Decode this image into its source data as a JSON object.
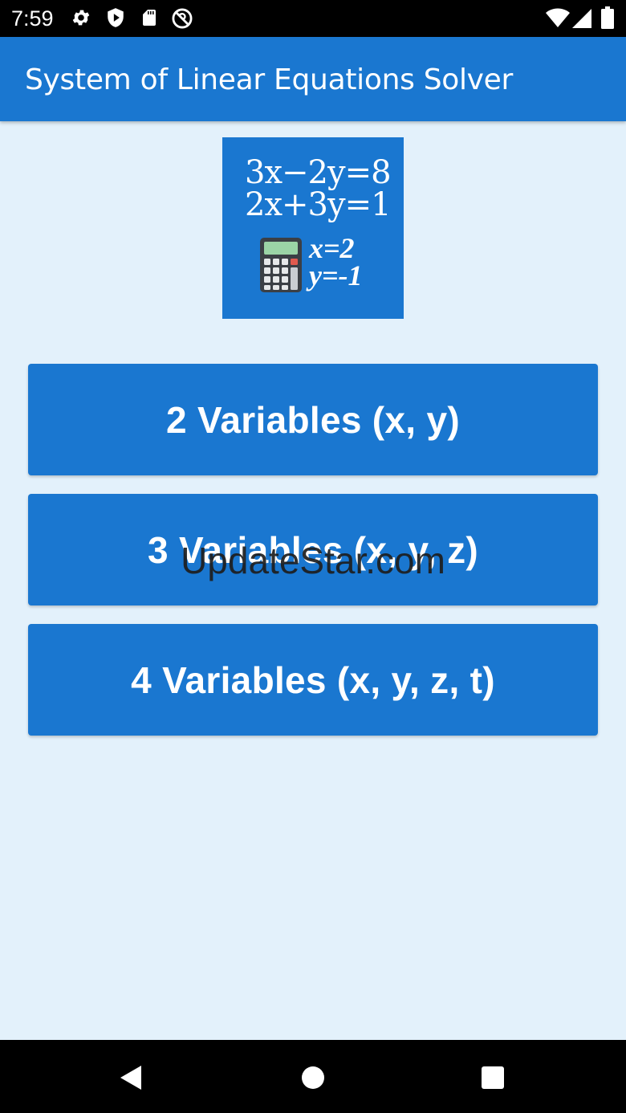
{
  "status_bar": {
    "time": "7:59",
    "left_icons": [
      "gear-icon",
      "shield-play-icon",
      "sd-card-icon",
      "dnd-icon"
    ],
    "right_icons": [
      "wifi-icon",
      "signal-icon",
      "battery-icon"
    ]
  },
  "app_bar": {
    "title": "System of Linear Equations Solver",
    "color": "#1a77d0"
  },
  "logo": {
    "equation_1": "3x−2y=8",
    "equation_2": "2x+3y=1",
    "solution_x": "x=2",
    "solution_y": "y=-1",
    "icon": "calculator-icon"
  },
  "buttons": [
    {
      "label": "2 Variables (x, y)"
    },
    {
      "label": "3 Variables (x, y, z)"
    },
    {
      "label": "4 Variables (x, y, z, t)"
    }
  ],
  "watermark": "UpdateStar.com",
  "nav_bar": {
    "icons": [
      "back-icon",
      "home-icon",
      "recents-icon"
    ]
  },
  "colors": {
    "primary": "#1a77d0",
    "background": "#e3f1fb"
  }
}
